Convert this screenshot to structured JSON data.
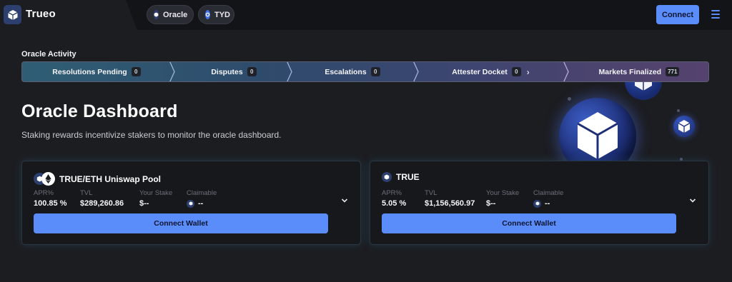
{
  "header": {
    "brand": "Trueo",
    "pills": [
      {
        "label": "Oracle"
      },
      {
        "label": "TYD"
      }
    ],
    "connect_label": "Connect"
  },
  "activity": {
    "title": "Oracle Activity",
    "segments": [
      {
        "label": "Resolutions Pending",
        "count": "0"
      },
      {
        "label": "Disputes",
        "count": "0"
      },
      {
        "label": "Escalations",
        "count": "0"
      },
      {
        "label": "Attester Docket",
        "count": "0"
      },
      {
        "label": "Markets Finalized",
        "count": "771"
      }
    ]
  },
  "hero": {
    "title": "Oracle Dashboard",
    "subtitle": "Staking rewards incentivize stakers to monitor the oracle dashboard."
  },
  "cards": [
    {
      "title": "TRUE/ETH Uniswap Pool",
      "apr_label": "APR%",
      "apr_value": "100.85 %",
      "tvl_label": "TVL",
      "tvl_value": "$289,260.86",
      "stake_label": "Your Stake",
      "stake_value": "$--",
      "claimable_label": "Claimable",
      "claimable_value": "--",
      "button_label": "Connect Wallet"
    },
    {
      "title": "TRUE",
      "apr_label": "APR%",
      "apr_value": "5.05 %",
      "tvl_label": "TVL",
      "tvl_value": "$1,156,560.97",
      "stake_label": "Your Stake",
      "stake_value": "$--",
      "claimable_label": "Claimable",
      "claimable_value": "--",
      "button_label": "Connect Wallet"
    }
  ],
  "colors": {
    "accent": "#5b8dfa",
    "background": "#1c1d21",
    "topbar": "#131417",
    "card": "#17181c",
    "token_dark": "#2d3f6e"
  },
  "icons": {
    "logo": "cube-logo-icon",
    "menu": "hamburger-menu-icon",
    "oracle_pill": "trueo-token-icon",
    "tyd_pill": "tyd-token-icon",
    "eth": "ethereum-icon",
    "expand": "chevron-down-icon",
    "segment_arrow": "chevron-right-icon"
  }
}
